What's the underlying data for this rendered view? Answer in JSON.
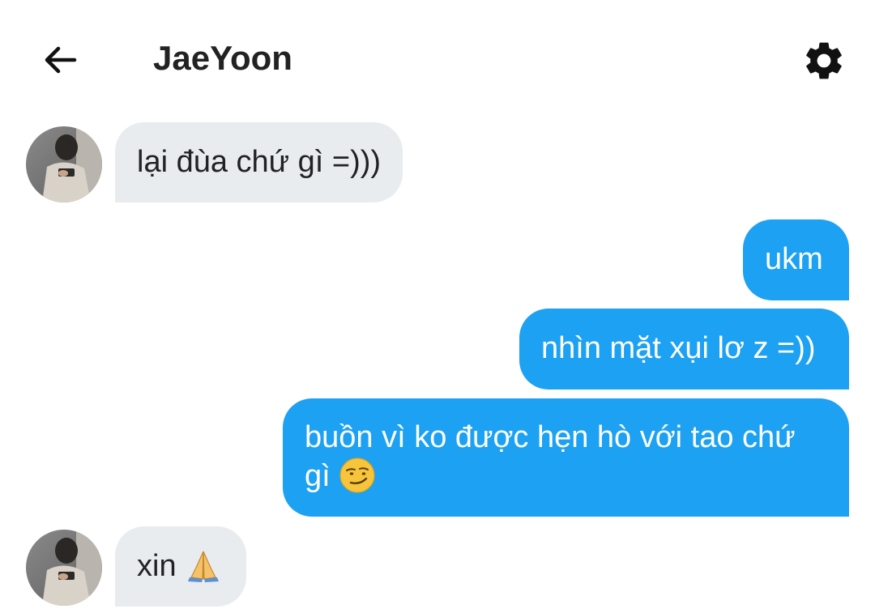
{
  "header": {
    "title": "JaeYoon",
    "back_icon": "arrow-left-icon",
    "settings_icon": "gear-icon"
  },
  "messages": [
    {
      "direction": "incoming",
      "text": "lại đùa chứ gì =)))"
    },
    {
      "direction": "outgoing",
      "text": "ukm"
    },
    {
      "direction": "outgoing",
      "text": "nhìn mặt xụi lơ z =))"
    },
    {
      "direction": "outgoing",
      "text": "buồn vì ko được hẹn hò với tao chứ",
      "text_line2": "gì",
      "emoji": "smirking-face-emoji"
    },
    {
      "direction": "incoming",
      "text": "xin",
      "emoji": "folded-hands-emoji"
    }
  ],
  "colors": {
    "incoming_bubble": "#e8ecef",
    "outgoing_bubble": "#1da1f2",
    "text_dark": "#222222",
    "text_light": "#ffffff"
  }
}
